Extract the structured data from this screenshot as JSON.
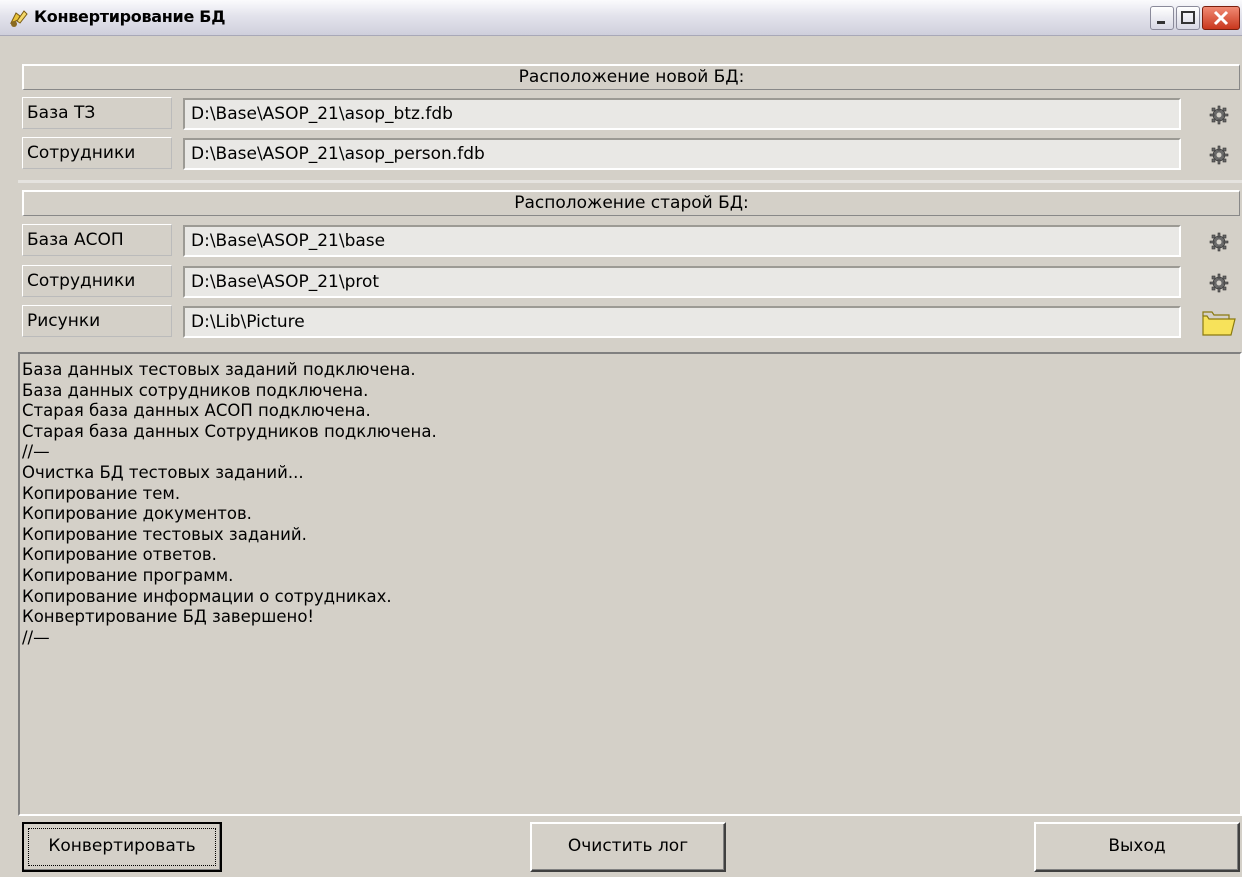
{
  "window": {
    "title": "Конвертирование БД",
    "icon": "app-icon"
  },
  "new_db": {
    "header": "Расположение новой БД:",
    "rows": [
      {
        "label": "База ТЗ",
        "value": "D:\\Base\\ASOP_21\\asop_btz.fdb",
        "button_icon": "gear-icon"
      },
      {
        "label": "Сотрудники",
        "value": "D:\\Base\\ASOP_21\\asop_person.fdb",
        "button_icon": "gear-icon"
      }
    ]
  },
  "old_db": {
    "header": "Расположение старой БД:",
    "rows": [
      {
        "label": "База АСОП",
        "value": "D:\\Base\\ASOP_21\\base",
        "button_icon": "gear-icon"
      },
      {
        "label": "Сотрудники",
        "value": "D:\\Base\\ASOP_21\\prot",
        "button_icon": "gear-icon"
      },
      {
        "label": "Рисунки",
        "value": "D:\\Lib\\Picture",
        "button_icon": "folder-icon"
      }
    ]
  },
  "log": [
    "База данных тестовых заданий подключена.",
    "База данных сотрудников подключена.",
    "Старая база данных АСОП подключена.",
    "Старая база данных Сотрудников подключена.",
    "//—",
    "Очистка БД тестовых заданий...",
    "Копирование тем.",
    "Копирование документов.",
    "Копирование тестовых заданий.",
    "Копирование ответов.",
    "Копирование программ.",
    "Копирование информации о сотрудниках.",
    "Конвертирование БД завершено!",
    "//—"
  ],
  "buttons": {
    "convert": "Конвертировать",
    "clear_log": "Очистить лог",
    "exit": "Выход"
  },
  "colors": {
    "face": "#d4d0c8",
    "field": "#e9e8e5",
    "folder": "#f7e25a"
  }
}
